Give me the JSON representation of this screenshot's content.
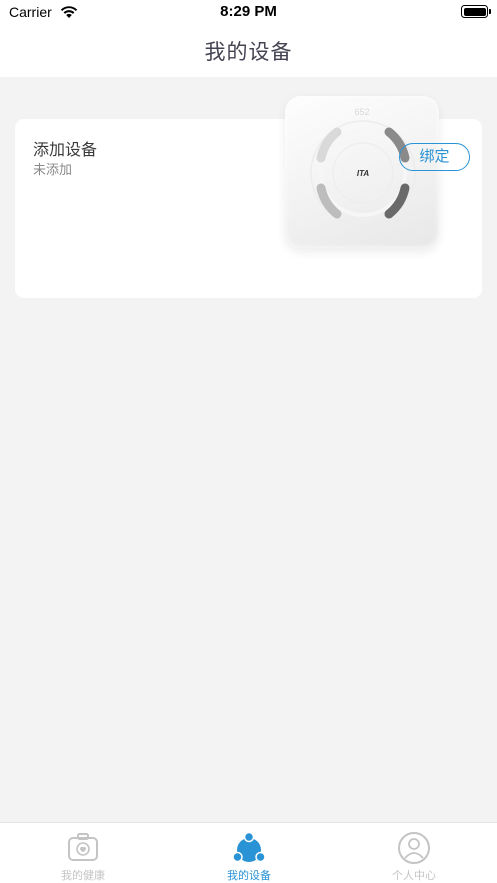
{
  "status_bar": {
    "carrier": "Carrier",
    "time": "8:29 PM"
  },
  "nav": {
    "title": "我的设备"
  },
  "device_card": {
    "title": "添加设备",
    "status": "未添加",
    "bind_button": "绑定",
    "scale_brand": "ITA",
    "scale_top_text": "652"
  },
  "tabs": [
    {
      "label": "我的健康",
      "icon": "medical-kit-icon",
      "active": false
    },
    {
      "label": "我的设备",
      "icon": "device-share-icon",
      "active": true
    },
    {
      "label": "个人中心",
      "icon": "person-icon",
      "active": false
    }
  ],
  "colors": {
    "accent": "#2a93d5",
    "background": "#f3f3f3",
    "inactive_tab": "#c4c4c4",
    "title_text": "#444452"
  }
}
